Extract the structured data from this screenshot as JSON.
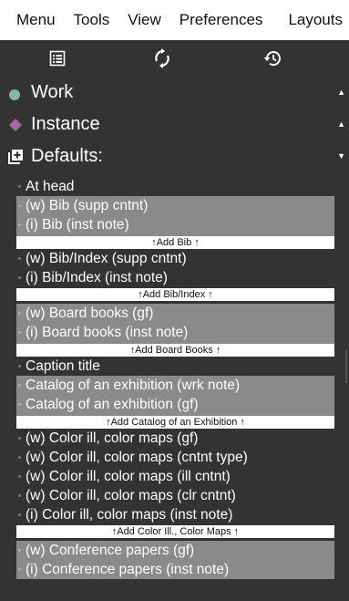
{
  "menubar": {
    "items": [
      "Menu",
      "Tools",
      "View",
      "Preferences",
      "Layouts"
    ]
  },
  "toolbar": {
    "icons": [
      "list-view-icon",
      "sync-icon",
      "history-icon"
    ]
  },
  "sections": {
    "work": {
      "label": "Work",
      "color": "#7fb8b0"
    },
    "instance": {
      "label": "Instance",
      "color": "#a865a8"
    },
    "defaults": {
      "label": "Defaults:"
    }
  },
  "entries": {
    "at_head": "At head",
    "bib_supp": "(w) Bib (supp cntnt)",
    "bib_inst": "(i) Bib (inst note)",
    "add_bib": "↑Add Bib ↑",
    "bibindex_supp": "(w) Bib/Index (supp cntnt)",
    "bibindex_inst": "(i) Bib/Index (inst note)",
    "add_bibindex": "↑Add Bib/Index ↑",
    "board_gf": "(w) Board books (gf)",
    "board_inst": "(i) Board books (inst note)",
    "add_board": "↑Add Board Books ↑",
    "caption": "Caption title",
    "catalog_wrk": "Catalog of an exhibition (wrk note)",
    "catalog_gf": "Catalog of an exhibition (gf)",
    "add_catalog": "↑Add Catalog of an Exhibition ↑",
    "color_gf": "(w) Color ill, color maps (gf)",
    "color_cntnt_type": "(w) Color ill, color maps (cntnt type)",
    "color_ill_cntnt": "(w) Color ill, color maps (ill cntnt)",
    "color_clr_cntnt": "(w) Color ill, color maps (clr cntnt)",
    "color_inst": "(i) Color ill, color maps (inst note)",
    "add_color": "↑Add Color Ill., Color Maps ↑",
    "conf_gf": "(w) Conference papers (gf)",
    "conf_inst": "(i) Conference papers (inst note)"
  },
  "colors": {
    "panel_bg": "#333333",
    "group_bg": "#8a8a8a",
    "button_bg": "#ffffff"
  }
}
